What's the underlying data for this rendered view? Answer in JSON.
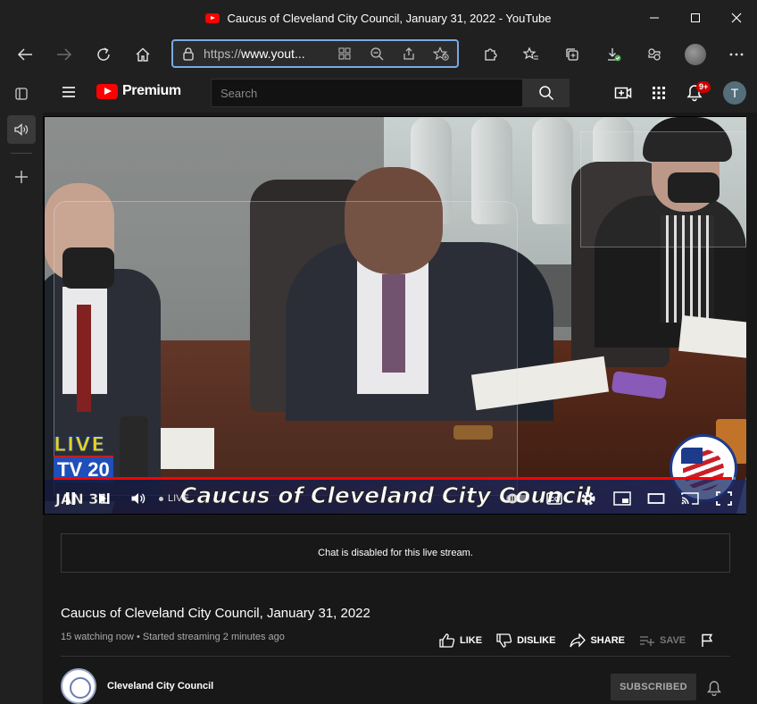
{
  "window": {
    "title": "Caucus of Cleveland City Council, January 31, 2022 - YouTube"
  },
  "address": {
    "url_prefix": "https://",
    "url_domain": "www.yout..."
  },
  "youtube": {
    "logo_text": "Premium",
    "search_placeholder": "Search",
    "notifications_badge": "9+",
    "avatar_initial": "T"
  },
  "player": {
    "live_logo_top": "LIVE",
    "live_logo_bottom": "TV 20",
    "banner_text": "Caucus of Cleveland City Council",
    "date_overlay": "JAN 31",
    "live_label": "LIVE",
    "progress_fraction": 0.995
  },
  "chat": {
    "message": "Chat is disabled for this live stream."
  },
  "video": {
    "title": "Caucus of Cleveland City Council, January 31, 2022",
    "meta": "15 watching now • Started streaming 2 minutes ago"
  },
  "actions": {
    "like": "LIKE",
    "dislike": "DISLIKE",
    "share": "SHARE",
    "save": "SAVE"
  },
  "channel": {
    "name": "Cleveland City Council",
    "subscribe_label": "SUBSCRIBED"
  },
  "colors": {
    "brand_red": "#ff0000",
    "address_border": "#79a9e6",
    "badge_red": "#cc0000"
  }
}
